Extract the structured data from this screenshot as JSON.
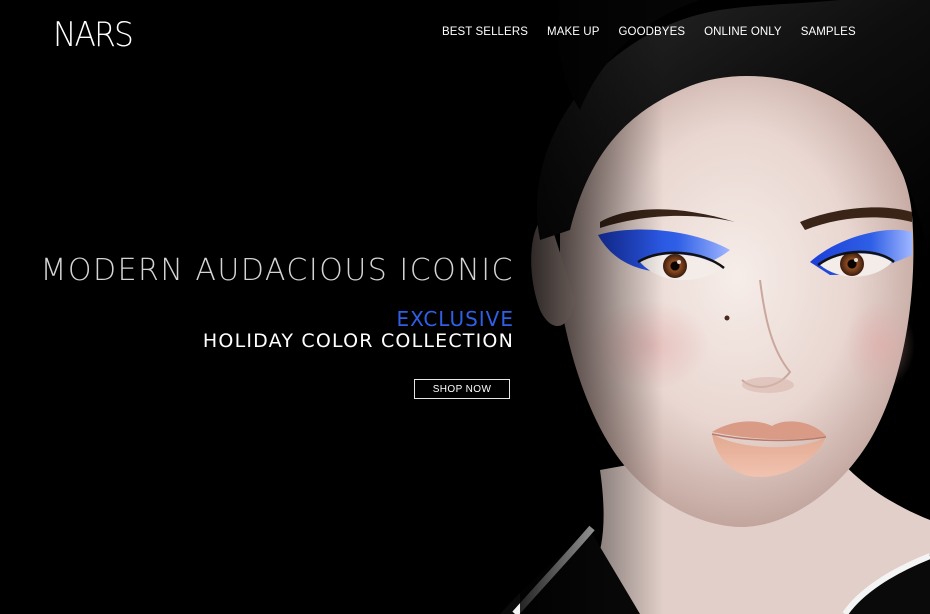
{
  "brand": {
    "logo_text": "NARS"
  },
  "nav": {
    "items": [
      {
        "label": "BEST SELLERS"
      },
      {
        "label": "MAKE UP"
      },
      {
        "label": "GOODBYES"
      },
      {
        "label": "ONLINE ONLY"
      },
      {
        "label": "SAMPLES"
      }
    ]
  },
  "hero": {
    "tagline": "MODERN AUDACIOUS ICONIC",
    "highlight": "EXCLUSIVE",
    "collection": "HOLIDAY COLOR COLLECTION",
    "cta_label": "SHOP NOW",
    "image_icon": "model-portrait-image"
  },
  "colors": {
    "background": "#000000",
    "accent_blue": "#2f5fe6",
    "text_light": "#d4d4d4",
    "text_white": "#ffffff"
  }
}
